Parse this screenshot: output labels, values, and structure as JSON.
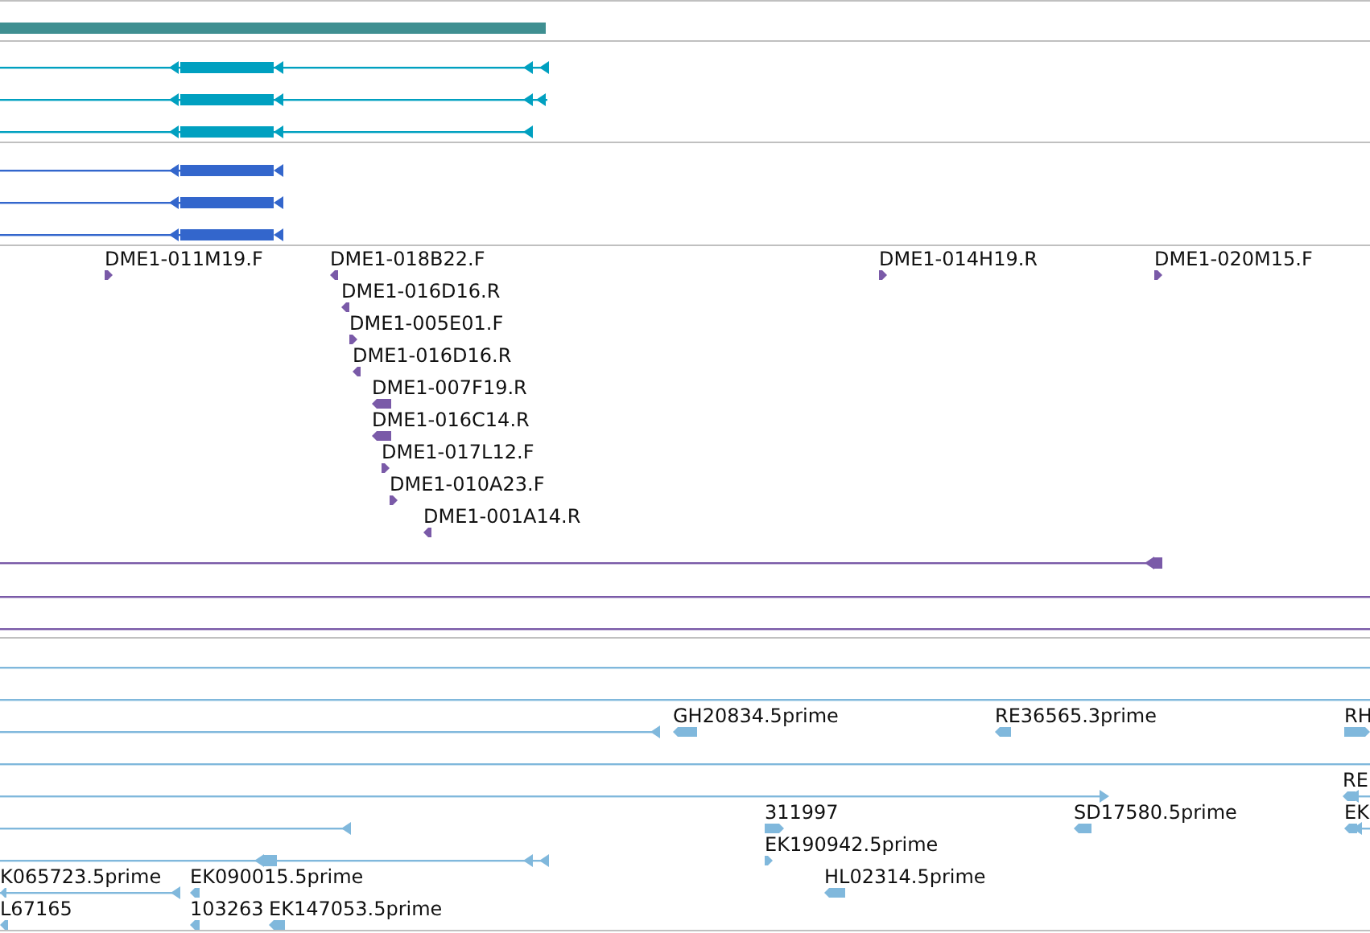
{
  "tracks": [
    {
      "kind": "bar",
      "color": "#3f8f91"
    },
    {
      "kind": "gene-models",
      "color": "#00a0c0"
    },
    {
      "kind": "gene-models",
      "color": "#3366cc"
    },
    {
      "kind": "clones",
      "color": "#7a5aa8",
      "labels": [
        {
          "text": "DME1-011M19.F",
          "reverse": false
        },
        {
          "text": "DME1-018B22.F",
          "reverse": true
        },
        {
          "text": "DME1-014H19.R",
          "reverse": false
        },
        {
          "text": "DME1-020M15.F",
          "reverse": false
        },
        {
          "text": "DME1-016D16.R",
          "reverse": true
        },
        {
          "text": "DME1-005E01.F",
          "reverse": false
        },
        {
          "text": "DME1-016D16.R",
          "reverse": true
        },
        {
          "text": "DME1-007F19.R",
          "reverse": true
        },
        {
          "text": "DME1-016C14.R",
          "reverse": true
        },
        {
          "text": "DME1-017L12.F",
          "reverse": false
        },
        {
          "text": "DME1-010A23.F",
          "reverse": false
        },
        {
          "text": "DME1-001A14.R",
          "reverse": true
        }
      ]
    },
    {
      "kind": "ests",
      "color": "#80b8dc",
      "labels": [
        {
          "text": "GH20834.5prime",
          "reverse": true
        },
        {
          "text": "RE36565.3prime",
          "reverse": true
        },
        {
          "text": "RH",
          "reverse": false
        },
        {
          "text": "RE",
          "reverse": true
        },
        {
          "text": "311997",
          "reverse": false
        },
        {
          "text": "SD17580.5prime",
          "reverse": true
        },
        {
          "text": "EK",
          "reverse": true
        },
        {
          "text": "EK190942.5prime",
          "reverse": false
        },
        {
          "text": "K065723.5prime",
          "reverse": true
        },
        {
          "text": "EK090015.5prime",
          "reverse": true
        },
        {
          "text": "HL02314.5prime",
          "reverse": true
        },
        {
          "text": "L67165",
          "reverse": true
        },
        {
          "text": "103263",
          "reverse": true
        },
        {
          "text": "EK147053.5prime",
          "reverse": true
        }
      ]
    }
  ]
}
